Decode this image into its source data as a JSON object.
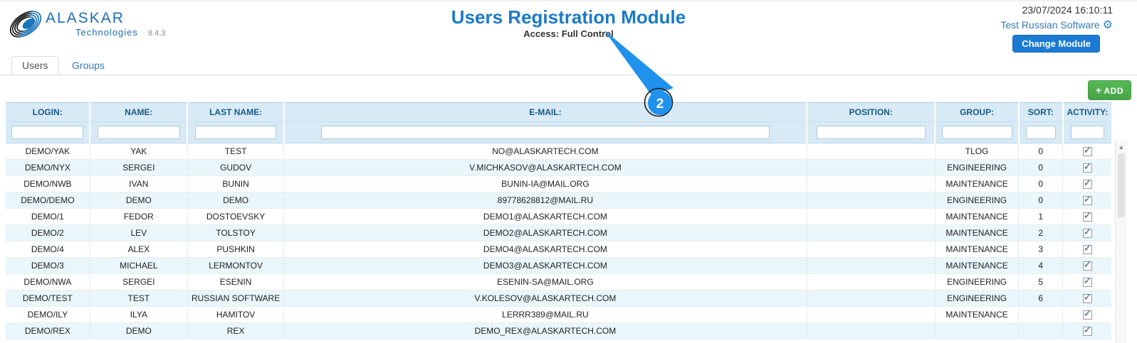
{
  "header": {
    "logo_text": "ALASKAR",
    "logo_subtext": "Technologies",
    "version": "8.4.3",
    "title": "Users Registration Module",
    "subtitle": "Access: Full Control",
    "datetime": "23/07/2024 16:10:11",
    "module_link": "Test Russian Software",
    "change_module_label": "Change Module"
  },
  "tabs": [
    {
      "label": "Users",
      "active": true
    },
    {
      "label": "Groups",
      "active": false
    }
  ],
  "toolbar": {
    "add_label": "ADD"
  },
  "callout": {
    "number": "2",
    "color": "#2191ee"
  },
  "icons": {
    "gear": "⚙",
    "add_plus": "+",
    "checkbox_check": "✓",
    "scroll_up_arrow": "▲"
  },
  "colors": {
    "brand_blue": "#1e6cb5",
    "title_blue": "#1b7ac7",
    "link_blue": "#337ab7",
    "button_blue": "#1a7ad4",
    "button_green": "#47a447",
    "table_header_bg": "#d7eaf6",
    "row_alt_bg": "#e9f6fb",
    "callout_blue": "#2191ee"
  },
  "table": {
    "columns": [
      "LOGIN:",
      "NAME:",
      "LAST NAME:",
      "E-MAIL:",
      "POSITION:",
      "GROUP:",
      "SORT:",
      "ACTIVITY:"
    ],
    "column_keys": [
      "login",
      "name",
      "last_name",
      "email",
      "position",
      "group",
      "sort",
      "activity"
    ],
    "filters": {
      "login": "",
      "name": "",
      "last_name": "",
      "email": "",
      "position": "",
      "group": "",
      "sort": "",
      "activity": ""
    },
    "rows": [
      {
        "login": "DEMO/YAK",
        "name": "YAK",
        "last_name": "TEST",
        "email": "NO@ALASKARTECH.COM",
        "position": "",
        "group": "TLOG",
        "sort": "0",
        "active": true
      },
      {
        "login": "DEMO/NYX",
        "name": "SERGEI",
        "last_name": "GUDOV",
        "email": "V.MICHKASOV@ALASKARTECH.COM",
        "position": "",
        "group": "ENGINEERING",
        "sort": "0",
        "active": true
      },
      {
        "login": "DEMO/NWB",
        "name": "IVAN",
        "last_name": "BUNIN",
        "email": "BUNIN-IA@MAIL.ORG",
        "position": "",
        "group": "MAINTENANCE",
        "sort": "0",
        "active": true
      },
      {
        "login": "DEMO/DEMO",
        "name": "DEMO",
        "last_name": "DEMO",
        "email": "89778628812@MAIL.RU",
        "position": "",
        "group": "ENGINEERING",
        "sort": "0",
        "active": true
      },
      {
        "login": "DEMO/1",
        "name": "FEDOR",
        "last_name": "DOSTOEVSKY",
        "email": "DEMO1@ALASKARTECH.COM",
        "position": "",
        "group": "MAINTENANCE",
        "sort": "1",
        "active": true
      },
      {
        "login": "DEMO/2",
        "name": "LEV",
        "last_name": "TOLSTOY",
        "email": "DEMO2@ALASKARTECH.COM",
        "position": "",
        "group": "MAINTENANCE",
        "sort": "2",
        "active": true
      },
      {
        "login": "DEMO/4",
        "name": "ALEX",
        "last_name": "PUSHKIN",
        "email": "DEMO4@ALASKARTECH.COM",
        "position": "",
        "group": "MAINTENANCE",
        "sort": "3",
        "active": true
      },
      {
        "login": "DEMO/3",
        "name": "MICHAEL",
        "last_name": "LERMONTOV",
        "email": "DEMO3@ALASKARTECH.COM",
        "position": "",
        "group": "MAINTENANCE",
        "sort": "4",
        "active": true
      },
      {
        "login": "DEMO/NWA",
        "name": "SERGEI",
        "last_name": "ESENIN",
        "email": "ESENIN-SA@MAIL.ORG",
        "position": "",
        "group": "ENGINEERING",
        "sort": "5",
        "active": true
      },
      {
        "login": "DEMO/TEST",
        "name": "TEST",
        "last_name": "RUSSIAN SOFTWARE",
        "email": "V.KOLESOV@ALASKARTECH.COM",
        "position": "",
        "group": "ENGINEERING",
        "sort": "6",
        "active": true
      },
      {
        "login": "DEMO/ILY",
        "name": "ILYA",
        "last_name": "HAMITOV",
        "email": "LERRR389@MAIL.RU",
        "position": "",
        "group": "MAINTENANCE",
        "sort": "",
        "active": true
      },
      {
        "login": "DEMO/REX",
        "name": "DEMO",
        "last_name": "REX",
        "email": "DEMO_REX@ALASKARTECH.COM",
        "position": "",
        "group": "",
        "sort": "",
        "active": true
      }
    ]
  }
}
